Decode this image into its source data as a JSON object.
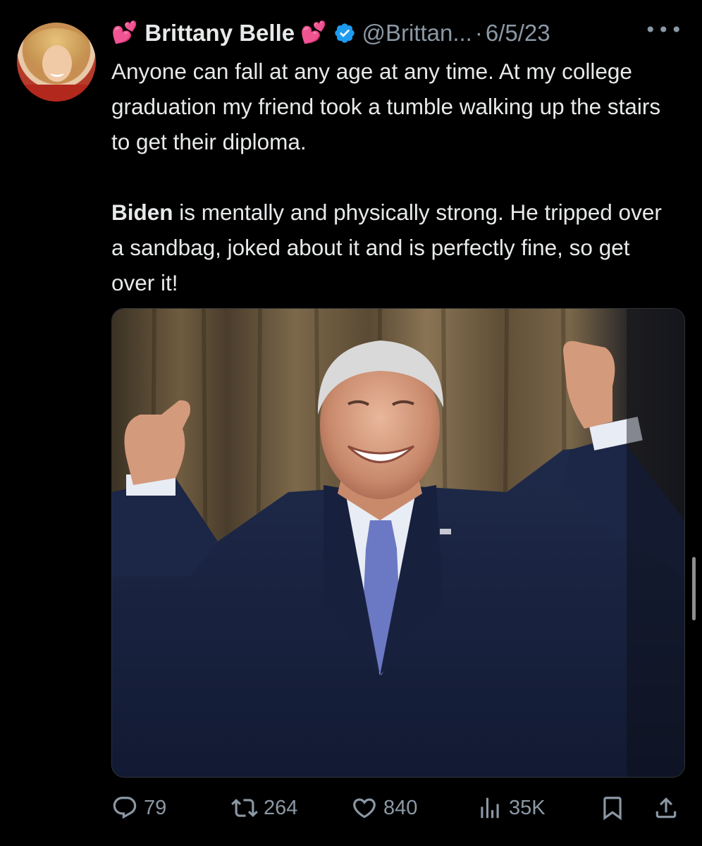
{
  "author": {
    "emoji_left": "💕",
    "display_name": "Brittany Belle",
    "emoji_right": "💕",
    "handle": "@Brittan...",
    "separator": "·",
    "date": "6/5/23",
    "verified": true
  },
  "tweet": {
    "paragraph_1": "Anyone can fall at any age at any time. At my college graduation my friend took a tumble walking up the stairs to get their diploma.",
    "paragraph_2_bold": "Biden",
    "paragraph_2_rest": " is mentally and physically strong. He tripped over a sandbag, joked about it and is perfectly fine, so get over it!"
  },
  "actions": {
    "replies": "79",
    "reposts": "264",
    "likes": "840",
    "views": "35K"
  },
  "icons": {
    "more": "more-options-icon",
    "reply": "reply-icon",
    "repost": "repost-icon",
    "like": "like-icon",
    "views": "views-icon",
    "bookmark": "bookmark-icon",
    "share": "share-icon"
  },
  "colors": {
    "background": "#000000",
    "text": "#e7e9ea",
    "muted": "#8b98a5",
    "verified": "#1d9bf0",
    "heart": "#ff3ea5"
  }
}
